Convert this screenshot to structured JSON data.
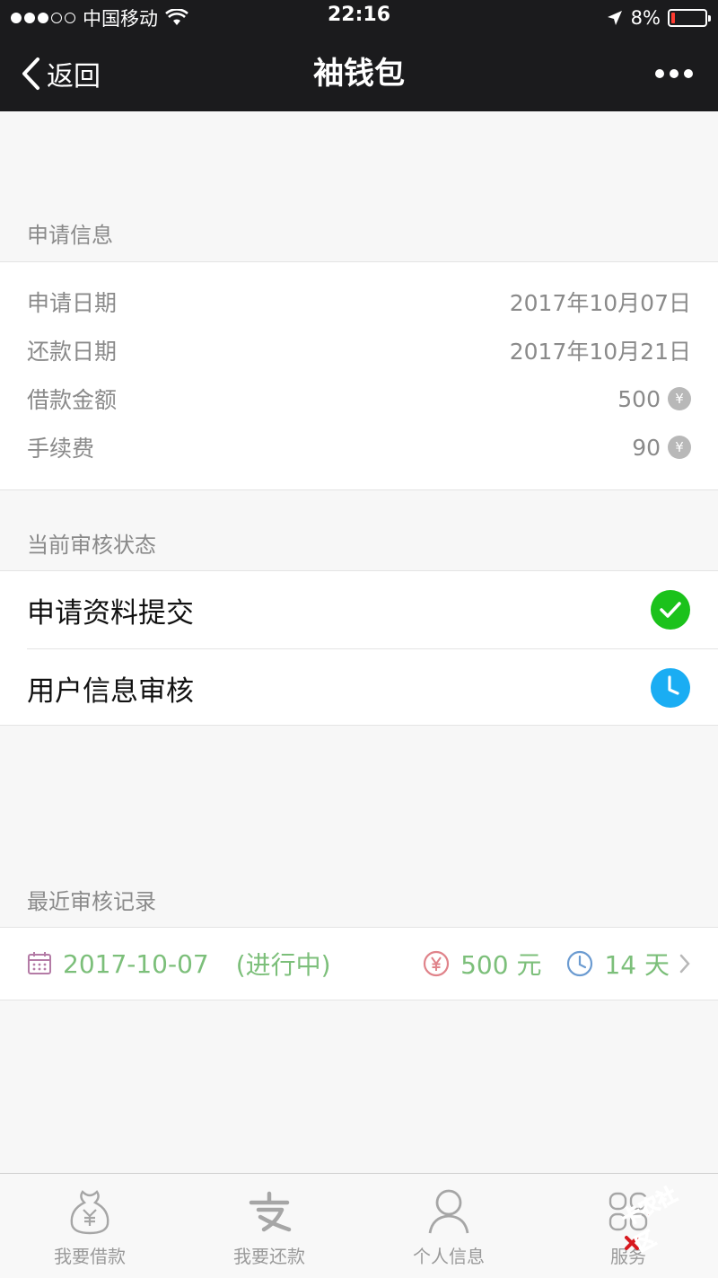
{
  "status_bar": {
    "carrier": "中国移动",
    "time": "22:16",
    "battery": "8%"
  },
  "nav": {
    "back_label": "返回",
    "title": "袖钱包"
  },
  "apply_info": {
    "header": "申请信息",
    "rows": [
      {
        "label": "申请日期",
        "value": "2017年10月07日"
      },
      {
        "label": "还款日期",
        "value": "2017年10月21日"
      },
      {
        "label": "借款金额",
        "value": "500"
      },
      {
        "label": "手续费",
        "value": "90"
      }
    ],
    "currency_symbol": "¥"
  },
  "review_status": {
    "header": "当前审核状态",
    "steps": [
      {
        "label": "申请资料提交",
        "state_icon": "check-circle-icon",
        "color": "#1bc21b"
      },
      {
        "label": "用户信息审核",
        "state_icon": "clock-icon",
        "color": "#1aadf3"
      }
    ]
  },
  "recent_records": {
    "header": "最近审核记录",
    "items": [
      {
        "date": "2017-10-07",
        "status": "(进行中)",
        "amount": "500 元",
        "days": "14 天"
      }
    ]
  },
  "tabs": [
    {
      "label": "我要借款",
      "icon": "money-bag-icon"
    },
    {
      "label": "我要还款",
      "icon": "alipay-icon"
    },
    {
      "label": "个人信息",
      "icon": "person-icon"
    },
    {
      "label": "服务",
      "icon": "grid-icon"
    }
  ],
  "watermark": "卡农社区",
  "colors": {
    "bar_bg": "#1b1b1d",
    "accent_green": "#7cbf7a",
    "success": "#1bc21b",
    "pending": "#1aadf3"
  }
}
